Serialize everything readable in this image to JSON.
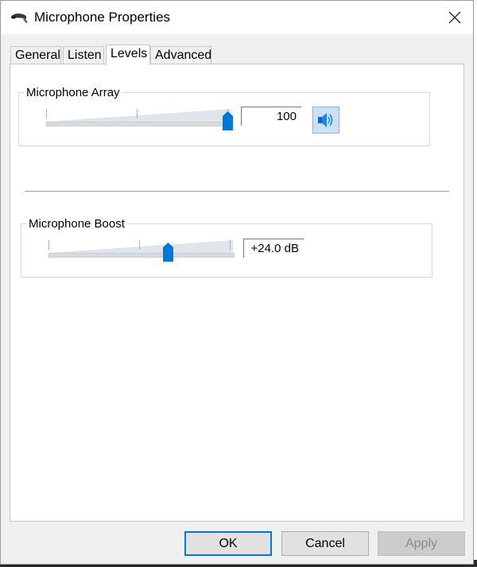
{
  "window": {
    "title": "Microphone Properties",
    "icon": "microphone-icon"
  },
  "tabs": [
    {
      "label": "General",
      "active": false
    },
    {
      "label": "Listen",
      "active": false
    },
    {
      "label": "Levels",
      "active": true
    },
    {
      "label": "Advanced",
      "active": false
    }
  ],
  "levels": {
    "array": {
      "label": "Microphone Array",
      "value": "100",
      "level_fraction": 1.0,
      "mute_icon": "speaker-icon"
    },
    "boost": {
      "label": "Microphone Boost",
      "value": "+24.0 dB",
      "level_fraction": 0.66
    }
  },
  "buttons": {
    "ok": "OK",
    "cancel": "Cancel",
    "apply": "Apply"
  },
  "colors": {
    "accent": "#0078d7",
    "thumb": "#0078d7"
  }
}
